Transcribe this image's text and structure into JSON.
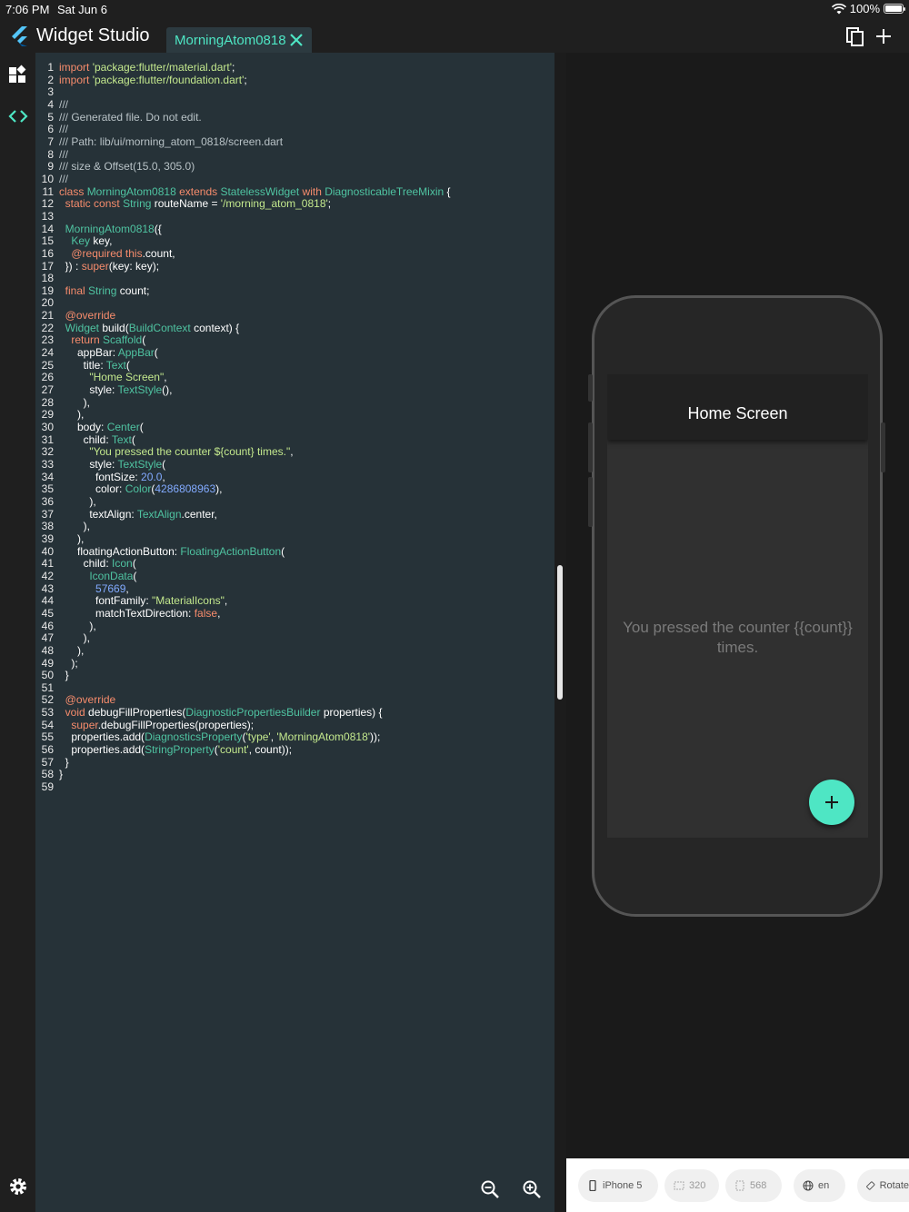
{
  "status_bar": {
    "time": "7:06 PM",
    "date": "Sat Jun 6",
    "battery": "100%"
  },
  "app": {
    "title": "Widget Studio",
    "tab_label": "MorningAtom0818"
  },
  "icons": {
    "logo": "flutter-logo-icon",
    "copy": "copy-icon",
    "add": "add-icon",
    "widgets": "widgets-icon",
    "code": "code-icon",
    "settings": "gear-icon",
    "zoom_out": "zoom-out-icon",
    "zoom_in": "zoom-in-icon",
    "close": "close-icon"
  },
  "colors": {
    "accent": "#4ee6c4",
    "editor_bg": "#263238"
  },
  "code_lines": [
    "import 'package:flutter/material.dart';",
    "import 'package:flutter/foundation.dart';",
    "",
    "///",
    "/// Generated file. Do not edit.",
    "///",
    "/// Path: lib/ui/morning_atom_0818/screen.dart",
    "///",
    "/// size & Offset(15.0, 305.0)",
    "///",
    "class MorningAtom0818 extends StatelessWidget with DiagnosticableTreeMixin {",
    "  static const String routeName = '/morning_atom_0818';",
    "",
    "  MorningAtom0818({",
    "    Key key,",
    "    @required this.count,",
    "  }) : super(key: key);",
    "",
    "  final String count;",
    "",
    "  @override",
    "  Widget build(BuildContext context) {",
    "    return Scaffold(",
    "      appBar: AppBar(",
    "        title: Text(",
    "          \"Home Screen\",",
    "          style: TextStyle(),",
    "        ),",
    "      ),",
    "      body: Center(",
    "        child: Text(",
    "          \"You pressed the counter ${count} times.\",",
    "          style: TextStyle(",
    "            fontSize: 20.0,",
    "            color: Color(4286808963),",
    "          ),",
    "          textAlign: TextAlign.center,",
    "        ),",
    "      ),",
    "      floatingActionButton: FloatingActionButton(",
    "        child: Icon(",
    "          IconData(",
    "            57669,",
    "            fontFamily: \"MaterialIcons\",",
    "            matchTextDirection: false,",
    "          ),",
    "        ),",
    "      ),",
    "    );",
    "  }",
    "",
    "  @override",
    "  void debugFillProperties(DiagnosticPropertiesBuilder properties) {",
    "    super.debugFillProperties(properties);",
    "    properties.add(DiagnosticsProperty('type', 'MorningAtom0818'));",
    "    properties.add(StringProperty('count', count));",
    "  }",
    "}",
    ""
  ],
  "preview": {
    "app_bar_title": "Home Screen",
    "body_text": "You pressed the counter {{count}} times."
  },
  "bottom_bar": {
    "device": "iPhone 5",
    "width": "320",
    "height": "568",
    "locale": "en",
    "rotate": "Rotate"
  }
}
